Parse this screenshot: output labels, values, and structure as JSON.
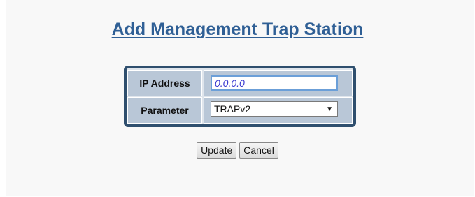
{
  "page": {
    "title": "Add Management Trap Station"
  },
  "form": {
    "ip_label": "IP Address",
    "ip_value": "0.0.0.0",
    "param_label": "Parameter",
    "param_selected": "TRAPv2"
  },
  "buttons": {
    "update": "Update",
    "cancel": "Cancel"
  },
  "colors": {
    "title": "#2f5f95",
    "form_border": "#2f4f6e",
    "label_bg": "#b9c7d7",
    "input_border": "#6b9fd8",
    "input_text": "#3a3ad0"
  }
}
